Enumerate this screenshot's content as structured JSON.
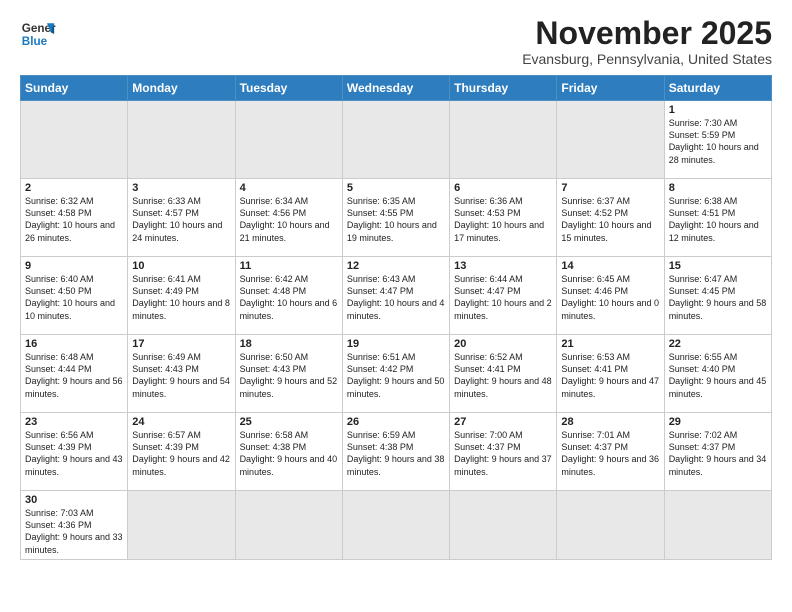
{
  "logo": {
    "line1": "General",
    "line2": "Blue"
  },
  "title": "November 2025",
  "subtitle": "Evansburg, Pennsylvania, United States",
  "days_header": [
    "Sunday",
    "Monday",
    "Tuesday",
    "Wednesday",
    "Thursday",
    "Friday",
    "Saturday"
  ],
  "weeks": [
    [
      {
        "num": "",
        "info": "",
        "empty": true
      },
      {
        "num": "",
        "info": "",
        "empty": true
      },
      {
        "num": "",
        "info": "",
        "empty": true
      },
      {
        "num": "",
        "info": "",
        "empty": true
      },
      {
        "num": "",
        "info": "",
        "empty": true
      },
      {
        "num": "",
        "info": "",
        "empty": true
      },
      {
        "num": "1",
        "info": "Sunrise: 7:30 AM\nSunset: 5:59 PM\nDaylight: 10 hours\nand 28 minutes."
      }
    ],
    [
      {
        "num": "2",
        "info": "Sunrise: 6:32 AM\nSunset: 4:58 PM\nDaylight: 10 hours\nand 26 minutes."
      },
      {
        "num": "3",
        "info": "Sunrise: 6:33 AM\nSunset: 4:57 PM\nDaylight: 10 hours\nand 24 minutes."
      },
      {
        "num": "4",
        "info": "Sunrise: 6:34 AM\nSunset: 4:56 PM\nDaylight: 10 hours\nand 21 minutes."
      },
      {
        "num": "5",
        "info": "Sunrise: 6:35 AM\nSunset: 4:55 PM\nDaylight: 10 hours\nand 19 minutes."
      },
      {
        "num": "6",
        "info": "Sunrise: 6:36 AM\nSunset: 4:53 PM\nDaylight: 10 hours\nand 17 minutes."
      },
      {
        "num": "7",
        "info": "Sunrise: 6:37 AM\nSunset: 4:52 PM\nDaylight: 10 hours\nand 15 minutes."
      },
      {
        "num": "8",
        "info": "Sunrise: 6:38 AM\nSunset: 4:51 PM\nDaylight: 10 hours\nand 12 minutes."
      }
    ],
    [
      {
        "num": "9",
        "info": "Sunrise: 6:40 AM\nSunset: 4:50 PM\nDaylight: 10 hours\nand 10 minutes."
      },
      {
        "num": "10",
        "info": "Sunrise: 6:41 AM\nSunset: 4:49 PM\nDaylight: 10 hours\nand 8 minutes."
      },
      {
        "num": "11",
        "info": "Sunrise: 6:42 AM\nSunset: 4:48 PM\nDaylight: 10 hours\nand 6 minutes."
      },
      {
        "num": "12",
        "info": "Sunrise: 6:43 AM\nSunset: 4:47 PM\nDaylight: 10 hours\nand 4 minutes."
      },
      {
        "num": "13",
        "info": "Sunrise: 6:44 AM\nSunset: 4:47 PM\nDaylight: 10 hours\nand 2 minutes."
      },
      {
        "num": "14",
        "info": "Sunrise: 6:45 AM\nSunset: 4:46 PM\nDaylight: 10 hours\nand 0 minutes."
      },
      {
        "num": "15",
        "info": "Sunrise: 6:47 AM\nSunset: 4:45 PM\nDaylight: 9 hours\nand 58 minutes."
      }
    ],
    [
      {
        "num": "16",
        "info": "Sunrise: 6:48 AM\nSunset: 4:44 PM\nDaylight: 9 hours\nand 56 minutes."
      },
      {
        "num": "17",
        "info": "Sunrise: 6:49 AM\nSunset: 4:43 PM\nDaylight: 9 hours\nand 54 minutes."
      },
      {
        "num": "18",
        "info": "Sunrise: 6:50 AM\nSunset: 4:43 PM\nDaylight: 9 hours\nand 52 minutes."
      },
      {
        "num": "19",
        "info": "Sunrise: 6:51 AM\nSunset: 4:42 PM\nDaylight: 9 hours\nand 50 minutes."
      },
      {
        "num": "20",
        "info": "Sunrise: 6:52 AM\nSunset: 4:41 PM\nDaylight: 9 hours\nand 48 minutes."
      },
      {
        "num": "21",
        "info": "Sunrise: 6:53 AM\nSunset: 4:41 PM\nDaylight: 9 hours\nand 47 minutes."
      },
      {
        "num": "22",
        "info": "Sunrise: 6:55 AM\nSunset: 4:40 PM\nDaylight: 9 hours\nand 45 minutes."
      }
    ],
    [
      {
        "num": "23",
        "info": "Sunrise: 6:56 AM\nSunset: 4:39 PM\nDaylight: 9 hours\nand 43 minutes."
      },
      {
        "num": "24",
        "info": "Sunrise: 6:57 AM\nSunset: 4:39 PM\nDaylight: 9 hours\nand 42 minutes."
      },
      {
        "num": "25",
        "info": "Sunrise: 6:58 AM\nSunset: 4:38 PM\nDaylight: 9 hours\nand 40 minutes."
      },
      {
        "num": "26",
        "info": "Sunrise: 6:59 AM\nSunset: 4:38 PM\nDaylight: 9 hours\nand 38 minutes."
      },
      {
        "num": "27",
        "info": "Sunrise: 7:00 AM\nSunset: 4:37 PM\nDaylight: 9 hours\nand 37 minutes."
      },
      {
        "num": "28",
        "info": "Sunrise: 7:01 AM\nSunset: 4:37 PM\nDaylight: 9 hours\nand 36 minutes."
      },
      {
        "num": "29",
        "info": "Sunrise: 7:02 AM\nSunset: 4:37 PM\nDaylight: 9 hours\nand 34 minutes."
      }
    ],
    [
      {
        "num": "30",
        "info": "Sunrise: 7:03 AM\nSunset: 4:36 PM\nDaylight: 9 hours\nand 33 minutes.",
        "last": true
      },
      {
        "num": "",
        "info": "",
        "empty": true,
        "last": true
      },
      {
        "num": "",
        "info": "",
        "empty": true,
        "last": true
      },
      {
        "num": "",
        "info": "",
        "empty": true,
        "last": true
      },
      {
        "num": "",
        "info": "",
        "empty": true,
        "last": true
      },
      {
        "num": "",
        "info": "",
        "empty": true,
        "last": true
      },
      {
        "num": "",
        "info": "",
        "empty": true,
        "last": true
      }
    ]
  ]
}
